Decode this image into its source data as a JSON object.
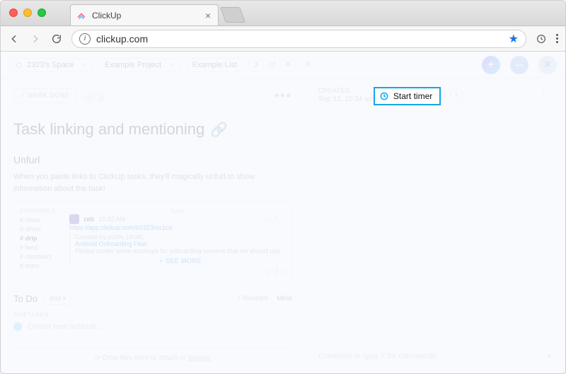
{
  "browser": {
    "tab_title": "ClickUp",
    "url": "clickup.com"
  },
  "breadcrumb": {
    "space": "2323's Space",
    "project": "Example Project",
    "list": "Example List",
    "index": "3",
    "of_label": "of",
    "total": "8"
  },
  "actions": {
    "mark_done": "✓ MARK DONE",
    "more": "•••"
  },
  "task": {
    "title": "Task linking and mentioning",
    "section_heading": "Unfurl",
    "section_body": "When you paste links to ClickUp tasks, they'll magically unfurl to show information about the task!",
    "embed": {
      "channels_label": "CHANNELS",
      "channels": [
        "ideas",
        "direct",
        "drip",
        "feed",
        "members",
        "team"
      ],
      "today_label": "Today",
      "user": "zeb",
      "time": "10:32 AM",
      "url_text": "https://app.clickup.com/t/2323/xx1ca",
      "line1": "Created by public (draft)",
      "line2": "Android Onboarding Flow",
      "line3": "Please create some mockups for onboarding screens that we should use",
      "see_more": "+ SEE MORE"
    },
    "todo_label": "To Do",
    "add_label": "Add ▾",
    "reorder_label": "↕ Reorder",
    "mine_label": "Mine",
    "subtasks_label": "SUBTASKS",
    "new_subtask_placeholder": "Create new subtask...",
    "dropzone_prefix": "⟳ Drop files here to attach or ",
    "dropzone_browse": "browse"
  },
  "meta": {
    "created_label": "CREATED",
    "created_value": "Sep 12, 10:34 am",
    "start_timer": "Start timer"
  },
  "comment": {
    "placeholder": "Comment or type '/' for commands"
  }
}
